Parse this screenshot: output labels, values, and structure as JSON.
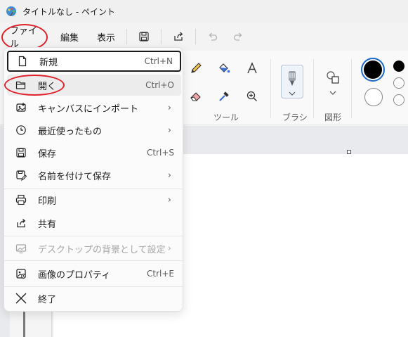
{
  "window": {
    "title": "タイトルなし - ペイント"
  },
  "menubar": {
    "file_label": "ファイル",
    "edit_label": "編集",
    "view_label": "表示"
  },
  "ribbon": {
    "tools_label": "ツール",
    "brush_label": "ブラシ",
    "shapes_label": "図形"
  },
  "file_menu": {
    "items": [
      {
        "icon": "new-file-icon",
        "label": "新規",
        "shortcut": "Ctrl+N",
        "submenu": false,
        "enabled": true
      },
      {
        "icon": "folder-open-icon",
        "label": "開く",
        "shortcut": "Ctrl+O",
        "submenu": false,
        "enabled": true
      },
      {
        "icon": "import-icon",
        "label": "キャンバスにインポート",
        "shortcut": "",
        "submenu": true,
        "enabled": true
      },
      {
        "icon": "clock-icon",
        "label": "最近使ったもの",
        "shortcut": "",
        "submenu": true,
        "enabled": true
      },
      {
        "icon": "save-icon",
        "label": "保存",
        "shortcut": "Ctrl+S",
        "submenu": false,
        "enabled": true
      },
      {
        "icon": "save-as-icon",
        "label": "名前を付けて保存",
        "shortcut": "",
        "submenu": true,
        "enabled": true
      },
      {
        "icon": "print-icon",
        "label": "印刷",
        "shortcut": "",
        "submenu": true,
        "enabled": true
      },
      {
        "icon": "share-icon",
        "label": "共有",
        "shortcut": "",
        "submenu": false,
        "enabled": true
      },
      {
        "icon": "wallpaper-icon",
        "label": "デスクトップの背景として設定",
        "shortcut": "",
        "submenu": true,
        "enabled": false
      },
      {
        "icon": "image-properties-icon",
        "label": "画像のプロパティ",
        "shortcut": "Ctrl+E",
        "submenu": false,
        "enabled": true
      },
      {
        "icon": "close-icon",
        "label": "終了",
        "shortcut": "",
        "submenu": false,
        "enabled": true
      }
    ],
    "chevron": "›"
  },
  "colors": {
    "highlight": "#e0202a",
    "selected_color": "#000000"
  }
}
